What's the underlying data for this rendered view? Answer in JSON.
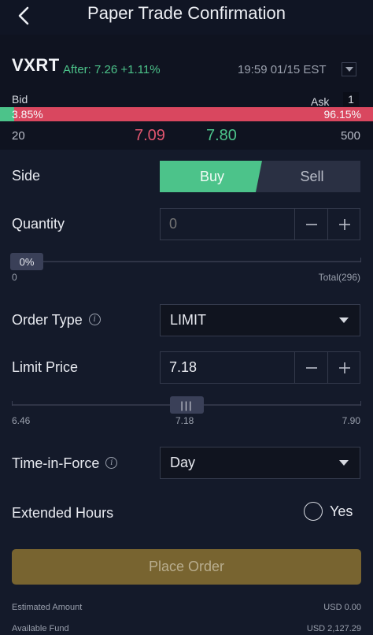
{
  "header": {
    "title": "Paper Trade Confirmation"
  },
  "quote": {
    "symbol": "VXRT",
    "after_hours": "After: 7.26 +1.11%",
    "timestamp": "19:59 01/15 EST",
    "bid_label": "Bid",
    "ask_label": "Ask",
    "ask_count": "1",
    "bid_pct": "3.85%",
    "ask_pct": "96.15%",
    "bid_pct_value": 3.85,
    "bid_size": "20",
    "bid_price": "7.09",
    "ask_price": "7.80",
    "ask_size": "500"
  },
  "side": {
    "label": "Side",
    "buy": "Buy",
    "sell": "Sell",
    "selected": "Buy"
  },
  "quantity": {
    "label": "Quantity",
    "placeholder": "0",
    "value": "",
    "percent": "0%",
    "min": "0",
    "total": "Total(296)"
  },
  "order_type": {
    "label": "Order Type",
    "value": "LIMIT"
  },
  "limit_price": {
    "label": "Limit Price",
    "value": "7.18",
    "min": "6.46",
    "mid": "7.18",
    "max": "7.90",
    "thumb": "|||"
  },
  "time_in_force": {
    "label": "Time-in-Force",
    "value": "Day"
  },
  "extended_hours": {
    "label": "Extended Hours",
    "option": "Yes",
    "checked": false
  },
  "place_order": {
    "label": "Place Order"
  },
  "footer": {
    "estimated_label": "Estimated Amount",
    "estimated_value": "USD  0.00",
    "available_label": "Available Fund",
    "available_value": "USD  2,127.29"
  },
  "colors": {
    "background": "#141a2a",
    "green": "#4cc38a",
    "red": "#d9475f",
    "gold": "#786430"
  },
  "icons": {
    "back": "back-arrow-icon",
    "dropdown": "caret-down-icon",
    "info": "info-icon",
    "minus": "minus-icon",
    "plus": "plus-icon"
  }
}
